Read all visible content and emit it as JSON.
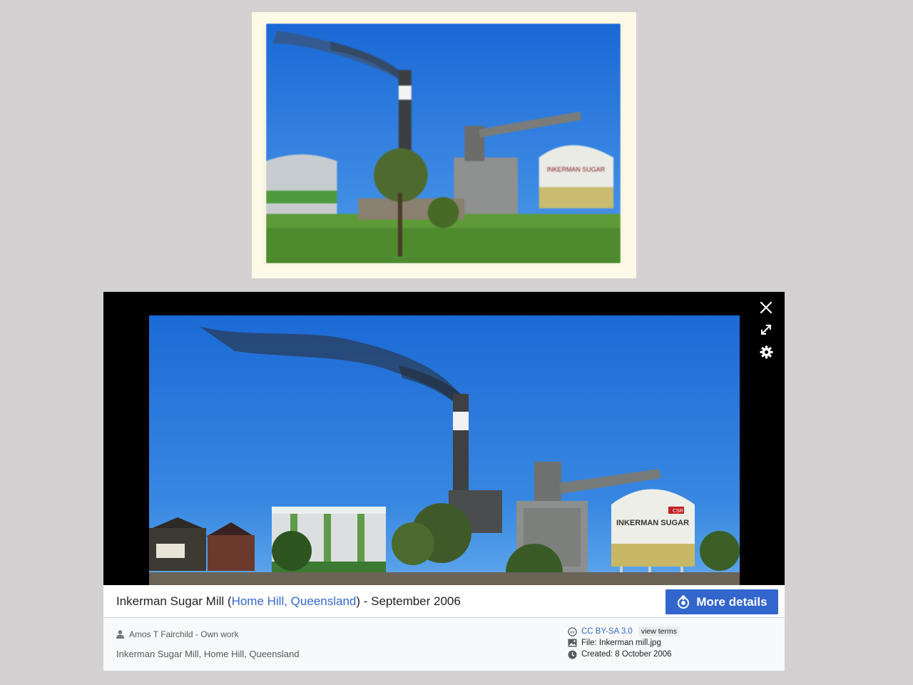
{
  "viewer": {
    "title_prefix": "Inkerman Sugar Mill (",
    "title_link": "Home Hill, Queensland",
    "title_suffix": ") - September 2006",
    "more_details_label": "More details",
    "author": "Amos T Fairchild - Own work",
    "description": "Inkerman Sugar Mill, Home Hill, Queensland",
    "license": "CC BY-SA 3.0",
    "view_terms": "view terms",
    "file": "File: Inkerman mill.jpg",
    "created": "Created: 8 October 2006"
  },
  "photo": {
    "silo_sign": "INKERMAN SUGAR",
    "silo_badge": "CSR"
  },
  "icons": {
    "close": "close-icon",
    "expand": "expand-icon",
    "settings": "gear-icon",
    "more_details": "commons-icon",
    "user": "user-icon",
    "license": "cc-icon",
    "file": "image-icon",
    "created": "clock-icon"
  },
  "colors": {
    "accent": "#3366cc",
    "viewer_background": "#000000",
    "page_background": "#d3d1d1",
    "thumbnail_mat": "#fdfbe8"
  }
}
